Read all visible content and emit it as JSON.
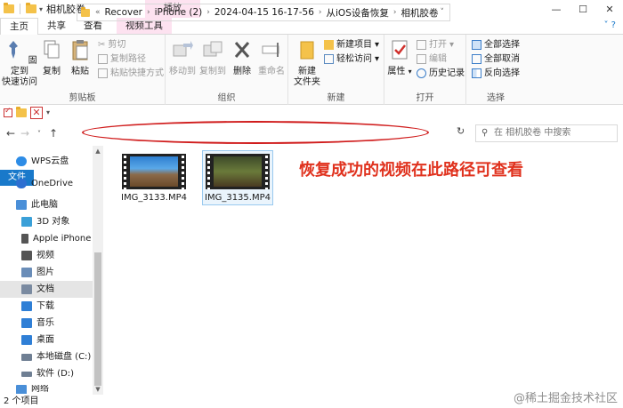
{
  "window": {
    "title": "相机胶卷",
    "context_tab_header": "播放",
    "controls": [
      "—",
      "☐",
      "✕"
    ]
  },
  "tabs": [
    "文件",
    "主页",
    "共享",
    "查看",
    "视频工具"
  ],
  "ribbon": {
    "clipboard": {
      "label": "剪贴板",
      "pin": "固定到\n快速访问",
      "copy": "复制",
      "paste": "粘贴",
      "cut": "剪切",
      "copy_path": "复制路径",
      "paste_shortcut": "粘贴快捷方式"
    },
    "organize": {
      "label": "组织",
      "move_to": "移动到",
      "copy_to": "复制到",
      "delete": "删除",
      "rename": "重命名"
    },
    "new": {
      "label": "新建",
      "new_folder": "新建\n文件夹",
      "new_item": "新建项目",
      "easy_access": "轻松访问"
    },
    "open": {
      "label": "打开",
      "properties": "属性",
      "open": "打开",
      "edit": "编辑",
      "history": "历史记录"
    },
    "select": {
      "label": "选择",
      "select_all": "全部选择",
      "select_none": "全部取消",
      "invert": "反向选择"
    }
  },
  "address": {
    "crumbs": [
      "Recover",
      "iPhone (2)",
      "2024-04-15 16-17-56",
      "从iOS设备恢复",
      "相机胶卷"
    ],
    "prefix": "«",
    "search_placeholder": "在 相机胶卷 中搜索"
  },
  "nav_pane": {
    "items": [
      {
        "label": "WPS云盘",
        "color": "#2d8ce6"
      },
      {
        "label": "OneDrive",
        "color": "#2d6fd1"
      },
      {
        "label": "此电脑",
        "color": "#4a8fd8"
      },
      {
        "label": "3D 对象",
        "color": "#3aa0d8"
      },
      {
        "label": "Apple iPhone",
        "color": "#555555"
      },
      {
        "label": "视频",
        "color": "#555555"
      },
      {
        "label": "图片",
        "color": "#6a8db8"
      },
      {
        "label": "文档",
        "color": "#7a8aa0"
      },
      {
        "label": "下载",
        "color": "#2f7fd6"
      },
      {
        "label": "音乐",
        "color": "#2f7fd6"
      },
      {
        "label": "桌面",
        "color": "#2f7fd6"
      },
      {
        "label": "本地磁盘 (C:)",
        "color": "#6f7f93"
      },
      {
        "label": "软件 (D:)",
        "color": "#6f7f93"
      },
      {
        "label": "网络",
        "color": "#4a8fd8"
      }
    ]
  },
  "files": [
    {
      "name": "IMG_3133.MP4"
    },
    {
      "name": "IMG_3135.MP4"
    }
  ],
  "annotation": "恢复成功的视频在此路径可查看",
  "status": "2 个项目",
  "watermark": "@稀土掘金技术社区",
  "colors": {
    "accent": "#1979ca",
    "annotation": "#e0321e",
    "context_tab": "#fde2f0"
  }
}
